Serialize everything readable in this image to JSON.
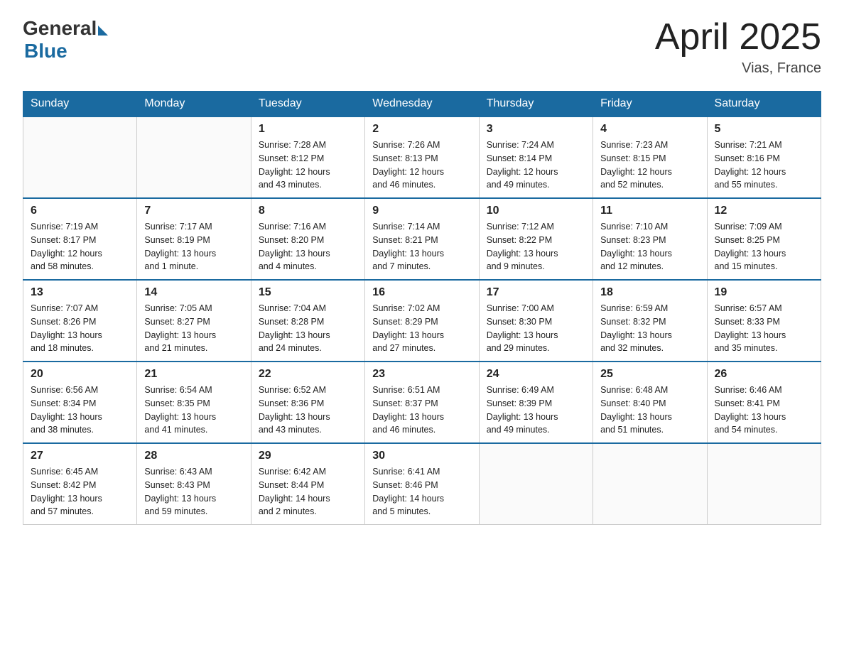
{
  "header": {
    "logo_general": "General",
    "logo_blue": "Blue",
    "month_title": "April 2025",
    "location": "Vias, France"
  },
  "days_of_week": [
    "Sunday",
    "Monday",
    "Tuesday",
    "Wednesday",
    "Thursday",
    "Friday",
    "Saturday"
  ],
  "weeks": [
    [
      {
        "day": "",
        "info": ""
      },
      {
        "day": "",
        "info": ""
      },
      {
        "day": "1",
        "info": "Sunrise: 7:28 AM\nSunset: 8:12 PM\nDaylight: 12 hours\nand 43 minutes."
      },
      {
        "day": "2",
        "info": "Sunrise: 7:26 AM\nSunset: 8:13 PM\nDaylight: 12 hours\nand 46 minutes."
      },
      {
        "day": "3",
        "info": "Sunrise: 7:24 AM\nSunset: 8:14 PM\nDaylight: 12 hours\nand 49 minutes."
      },
      {
        "day": "4",
        "info": "Sunrise: 7:23 AM\nSunset: 8:15 PM\nDaylight: 12 hours\nand 52 minutes."
      },
      {
        "day": "5",
        "info": "Sunrise: 7:21 AM\nSunset: 8:16 PM\nDaylight: 12 hours\nand 55 minutes."
      }
    ],
    [
      {
        "day": "6",
        "info": "Sunrise: 7:19 AM\nSunset: 8:17 PM\nDaylight: 12 hours\nand 58 minutes."
      },
      {
        "day": "7",
        "info": "Sunrise: 7:17 AM\nSunset: 8:19 PM\nDaylight: 13 hours\nand 1 minute."
      },
      {
        "day": "8",
        "info": "Sunrise: 7:16 AM\nSunset: 8:20 PM\nDaylight: 13 hours\nand 4 minutes."
      },
      {
        "day": "9",
        "info": "Sunrise: 7:14 AM\nSunset: 8:21 PM\nDaylight: 13 hours\nand 7 minutes."
      },
      {
        "day": "10",
        "info": "Sunrise: 7:12 AM\nSunset: 8:22 PM\nDaylight: 13 hours\nand 9 minutes."
      },
      {
        "day": "11",
        "info": "Sunrise: 7:10 AM\nSunset: 8:23 PM\nDaylight: 13 hours\nand 12 minutes."
      },
      {
        "day": "12",
        "info": "Sunrise: 7:09 AM\nSunset: 8:25 PM\nDaylight: 13 hours\nand 15 minutes."
      }
    ],
    [
      {
        "day": "13",
        "info": "Sunrise: 7:07 AM\nSunset: 8:26 PM\nDaylight: 13 hours\nand 18 minutes."
      },
      {
        "day": "14",
        "info": "Sunrise: 7:05 AM\nSunset: 8:27 PM\nDaylight: 13 hours\nand 21 minutes."
      },
      {
        "day": "15",
        "info": "Sunrise: 7:04 AM\nSunset: 8:28 PM\nDaylight: 13 hours\nand 24 minutes."
      },
      {
        "day": "16",
        "info": "Sunrise: 7:02 AM\nSunset: 8:29 PM\nDaylight: 13 hours\nand 27 minutes."
      },
      {
        "day": "17",
        "info": "Sunrise: 7:00 AM\nSunset: 8:30 PM\nDaylight: 13 hours\nand 29 minutes."
      },
      {
        "day": "18",
        "info": "Sunrise: 6:59 AM\nSunset: 8:32 PM\nDaylight: 13 hours\nand 32 minutes."
      },
      {
        "day": "19",
        "info": "Sunrise: 6:57 AM\nSunset: 8:33 PM\nDaylight: 13 hours\nand 35 minutes."
      }
    ],
    [
      {
        "day": "20",
        "info": "Sunrise: 6:56 AM\nSunset: 8:34 PM\nDaylight: 13 hours\nand 38 minutes."
      },
      {
        "day": "21",
        "info": "Sunrise: 6:54 AM\nSunset: 8:35 PM\nDaylight: 13 hours\nand 41 minutes."
      },
      {
        "day": "22",
        "info": "Sunrise: 6:52 AM\nSunset: 8:36 PM\nDaylight: 13 hours\nand 43 minutes."
      },
      {
        "day": "23",
        "info": "Sunrise: 6:51 AM\nSunset: 8:37 PM\nDaylight: 13 hours\nand 46 minutes."
      },
      {
        "day": "24",
        "info": "Sunrise: 6:49 AM\nSunset: 8:39 PM\nDaylight: 13 hours\nand 49 minutes."
      },
      {
        "day": "25",
        "info": "Sunrise: 6:48 AM\nSunset: 8:40 PM\nDaylight: 13 hours\nand 51 minutes."
      },
      {
        "day": "26",
        "info": "Sunrise: 6:46 AM\nSunset: 8:41 PM\nDaylight: 13 hours\nand 54 minutes."
      }
    ],
    [
      {
        "day": "27",
        "info": "Sunrise: 6:45 AM\nSunset: 8:42 PM\nDaylight: 13 hours\nand 57 minutes."
      },
      {
        "day": "28",
        "info": "Sunrise: 6:43 AM\nSunset: 8:43 PM\nDaylight: 13 hours\nand 59 minutes."
      },
      {
        "day": "29",
        "info": "Sunrise: 6:42 AM\nSunset: 8:44 PM\nDaylight: 14 hours\nand 2 minutes."
      },
      {
        "day": "30",
        "info": "Sunrise: 6:41 AM\nSunset: 8:46 PM\nDaylight: 14 hours\nand 5 minutes."
      },
      {
        "day": "",
        "info": ""
      },
      {
        "day": "",
        "info": ""
      },
      {
        "day": "",
        "info": ""
      }
    ]
  ]
}
